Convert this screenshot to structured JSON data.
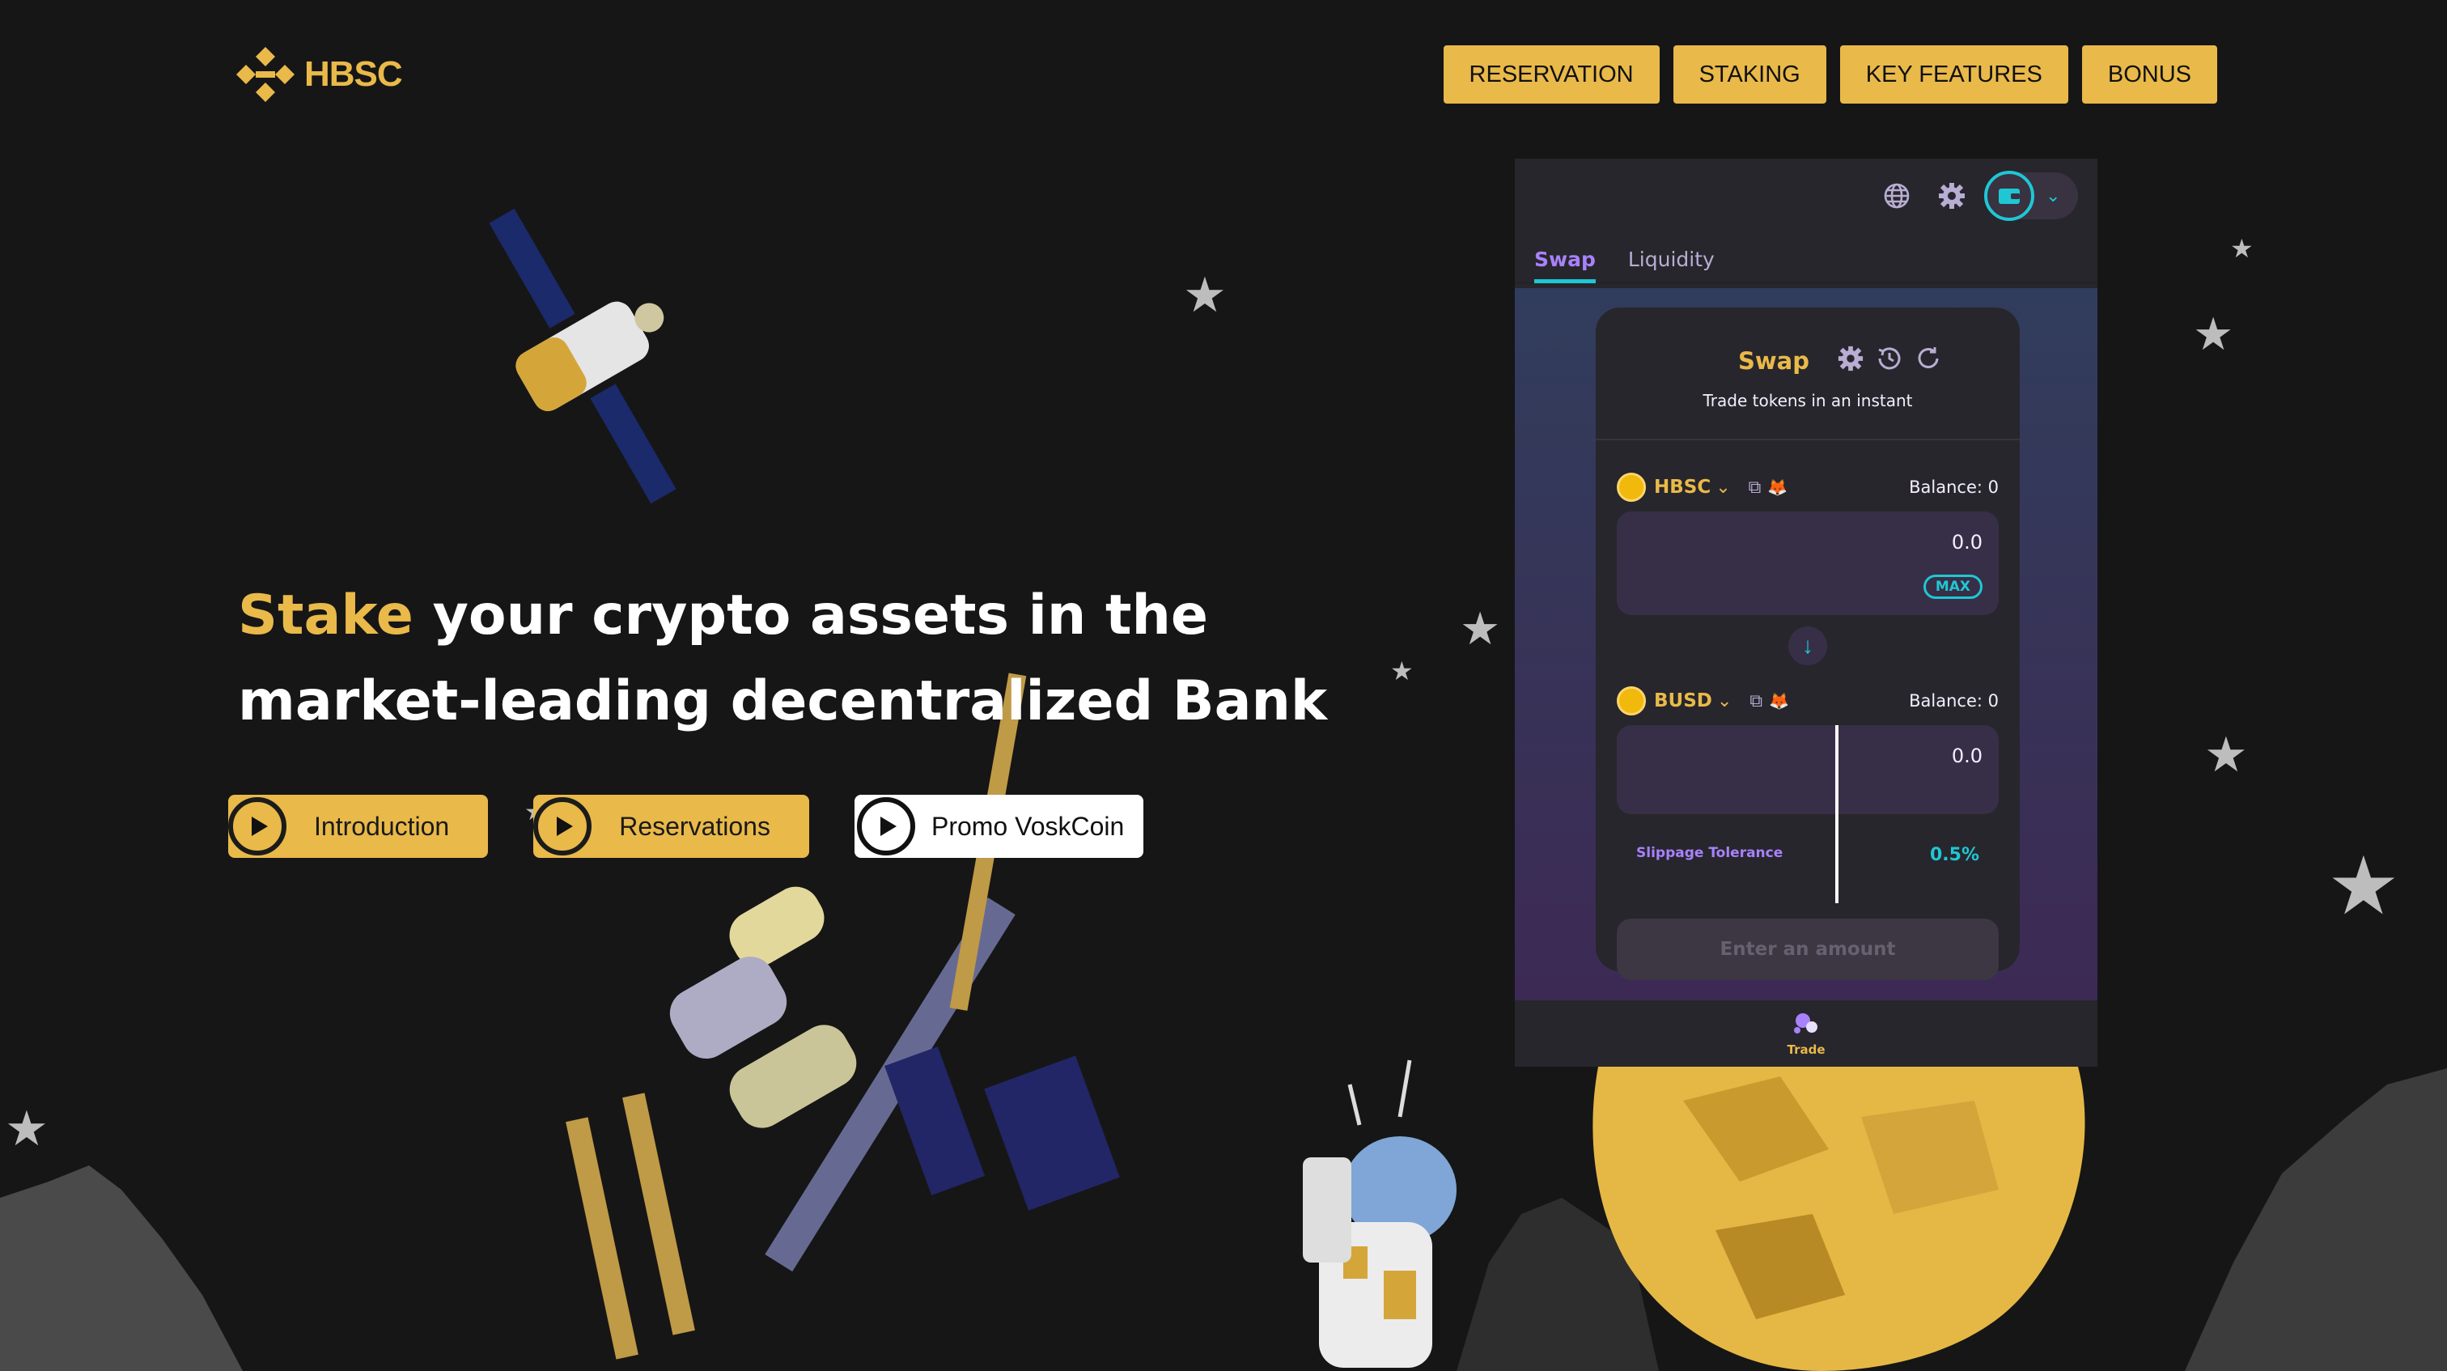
{
  "brand": {
    "name": "HBSC",
    "color": "#e9b949"
  },
  "nav": [
    "RESERVATION",
    "STAKING",
    "KEY FEATURES",
    "BONUS"
  ],
  "hero": {
    "headline_accent": "Stake",
    "headline_rest": "your crypto assets in the market-leading decentralized Bank",
    "buttons": [
      "Introduction",
      "Reservations",
      "Promo VoskCoin"
    ]
  },
  "widget": {
    "top_icons": [
      "globe-icon",
      "gear-icon",
      "wallet-icon",
      "chevron-down-icon"
    ],
    "tabs": [
      "Swap",
      "Liquidity"
    ],
    "card_title": "Swap",
    "card_subtitle": "Trade tokens in an instant",
    "from": {
      "token": "HBSC",
      "balance": "Balance: 0",
      "amount": "0.0",
      "max_label": "MAX"
    },
    "to": {
      "token": "BUSD",
      "balance": "Balance: 0",
      "amount": "0.0"
    },
    "slippage_label": "Slippage Tolerance",
    "slippage_value": "0.5%",
    "submit_label": "Enter an amount",
    "footer_label": "Trade"
  },
  "colors": {
    "accent": "#e9b949",
    "background": "#161616",
    "cyan": "#1fc7d4",
    "purple": "#a881fc"
  }
}
